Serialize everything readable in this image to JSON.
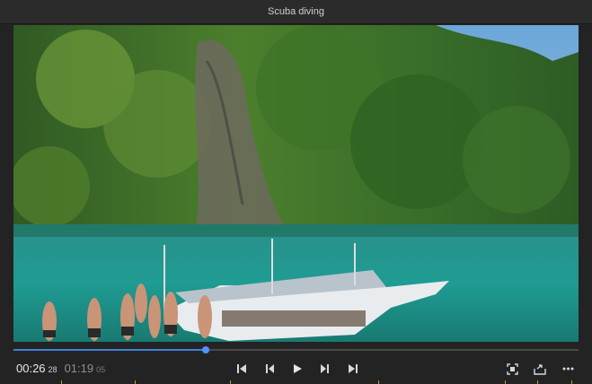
{
  "window": {
    "title": "Scuba diving"
  },
  "player": {
    "current_time": "00:26",
    "current_frames": "28",
    "duration": "01:19",
    "duration_frames": "05",
    "progress": 0.34
  },
  "icons": {
    "go_to_start": "skip-to-start-icon",
    "step_back": "step-back-icon",
    "play": "play-icon",
    "step_forward": "step-forward-icon",
    "go_to_end": "skip-to-end-icon",
    "fit": "fit-frame-icon",
    "export": "export-icon",
    "more": "more-options-icon"
  },
  "colors": {
    "accent": "#4f93ff",
    "marker": "#d09030"
  }
}
